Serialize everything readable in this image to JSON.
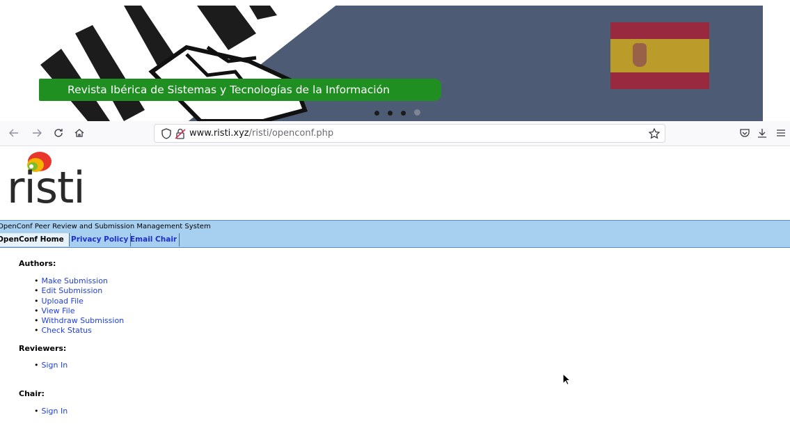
{
  "banner": {
    "caption": "Revista Ibérica de Sistemas y Tecnologías de la Información",
    "letters": "btt",
    "slide_dots": 4,
    "active_dots": 3
  },
  "browser": {
    "url_host": "www.risti.xyz",
    "url_path": "/risti/openconf.php"
  },
  "logo": {
    "wordmark": "risti"
  },
  "system_bar": {
    "text": "OpenConf Peer Review and Submission Management System"
  },
  "nav": {
    "home": "OpenConf Home",
    "privacy": "Privacy Policy",
    "email": "Email Chair"
  },
  "sections": {
    "authors": {
      "title": "Authors:",
      "links": [
        "Make Submission",
        "Edit Submission",
        "Upload File",
        "View File",
        "Withdraw Submission",
        "Check Status"
      ]
    },
    "reviewers": {
      "title": "Reviewers:",
      "links": [
        "Sign In"
      ]
    },
    "chair": {
      "title": "Chair:",
      "links": [
        "Sign In"
      ]
    }
  },
  "colors": {
    "banner_dark": "#4e5b74",
    "caption_green": "#1f8f21",
    "nav_blue": "#a7cff0",
    "link_blue": "#1e3ee0"
  }
}
